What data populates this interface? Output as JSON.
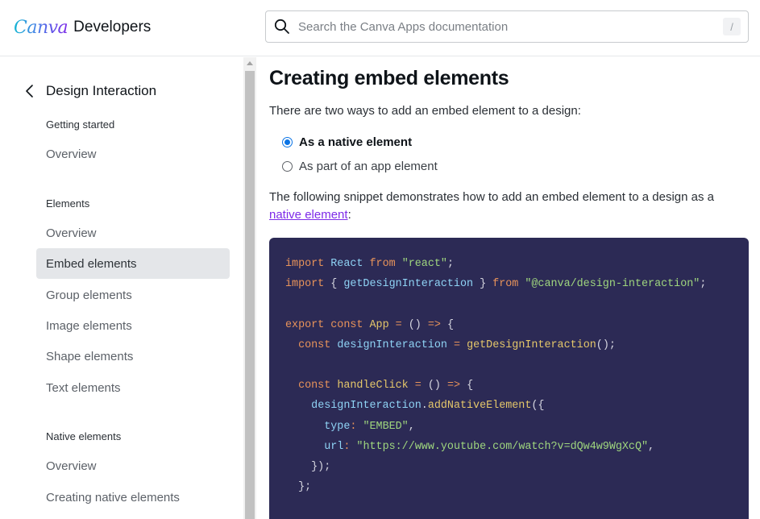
{
  "header": {
    "logo_brand": "Canva",
    "logo_product": "Developers",
    "search_placeholder": "Search the Canva Apps documentation",
    "search_value": "",
    "search_shortcut": "/"
  },
  "sidebar": {
    "back_title": "Design Interaction",
    "sections": [
      {
        "label": "Getting started",
        "items": [
          {
            "label": "Overview",
            "active": false
          }
        ]
      },
      {
        "label": "Elements",
        "items": [
          {
            "label": "Overview",
            "active": false
          },
          {
            "label": "Embed elements",
            "active": true
          },
          {
            "label": "Group elements",
            "active": false
          },
          {
            "label": "Image elements",
            "active": false
          },
          {
            "label": "Shape elements",
            "active": false
          },
          {
            "label": "Text elements",
            "active": false
          }
        ]
      },
      {
        "label": "Native elements",
        "items": [
          {
            "label": "Overview",
            "active": false
          },
          {
            "label": "Creating native elements",
            "active": false
          }
        ]
      }
    ]
  },
  "main": {
    "title": "Creating embed elements",
    "intro": "There are two ways to add an embed element to a design:",
    "options": [
      {
        "label": "As a native element",
        "selected": true
      },
      {
        "label": "As part of an app element",
        "selected": false
      }
    ],
    "paragraph_prefix": "The following snippet demonstrates how to add an embed element to a design as a ",
    "paragraph_link": "native element",
    "paragraph_suffix": ":",
    "code_lines": [
      [
        [
          "kw",
          "import"
        ],
        [
          "pun",
          " "
        ],
        [
          "id",
          "React"
        ],
        [
          "pun",
          " "
        ],
        [
          "kw",
          "from"
        ],
        [
          "pun",
          " "
        ],
        [
          "str",
          "\"react\""
        ],
        [
          "pun",
          ";"
        ]
      ],
      [
        [
          "kw",
          "import"
        ],
        [
          "pun",
          " { "
        ],
        [
          "id",
          "getDesignInteraction"
        ],
        [
          "pun",
          " } "
        ],
        [
          "kw",
          "from"
        ],
        [
          "pun",
          " "
        ],
        [
          "str",
          "\"@canva/design-interaction\""
        ],
        [
          "pun",
          ";"
        ]
      ],
      [],
      [
        [
          "kw",
          "export"
        ],
        [
          "pun",
          " "
        ],
        [
          "kw",
          "const"
        ],
        [
          "pun",
          " "
        ],
        [
          "fn",
          "App"
        ],
        [
          "pun",
          " "
        ],
        [
          "op",
          "="
        ],
        [
          "pun",
          " () "
        ],
        [
          "op",
          "=>"
        ],
        [
          "pun",
          " {"
        ]
      ],
      [
        [
          "pun",
          "  "
        ],
        [
          "kw",
          "const"
        ],
        [
          "pun",
          " "
        ],
        [
          "id",
          "designInteraction"
        ],
        [
          "pun",
          " "
        ],
        [
          "op",
          "="
        ],
        [
          "pun",
          " "
        ],
        [
          "fn",
          "getDesignInteraction"
        ],
        [
          "pun",
          "();"
        ]
      ],
      [],
      [
        [
          "pun",
          "  "
        ],
        [
          "kw",
          "const"
        ],
        [
          "pun",
          " "
        ],
        [
          "fn",
          "handleClick"
        ],
        [
          "pun",
          " "
        ],
        [
          "op",
          "="
        ],
        [
          "pun",
          " () "
        ],
        [
          "op",
          "=>"
        ],
        [
          "pun",
          " {"
        ]
      ],
      [
        [
          "pun",
          "    "
        ],
        [
          "id",
          "designInteraction"
        ],
        [
          "pun",
          "."
        ],
        [
          "fn",
          "addNativeElement"
        ],
        [
          "pun",
          "({"
        ]
      ],
      [
        [
          "pun",
          "      "
        ],
        [
          "id",
          "type"
        ],
        [
          "op",
          ":"
        ],
        [
          "pun",
          " "
        ],
        [
          "str",
          "\"EMBED\""
        ],
        [
          "pun",
          ","
        ]
      ],
      [
        [
          "pun",
          "      "
        ],
        [
          "id",
          "url"
        ],
        [
          "op",
          ":"
        ],
        [
          "pun",
          " "
        ],
        [
          "str",
          "\"https://www.youtube.com/watch?v=dQw4w9WgXcQ\""
        ],
        [
          "pun",
          ","
        ]
      ],
      [
        [
          "pun",
          "    });"
        ]
      ],
      [
        [
          "pun",
          "  };"
        ]
      ]
    ]
  }
}
